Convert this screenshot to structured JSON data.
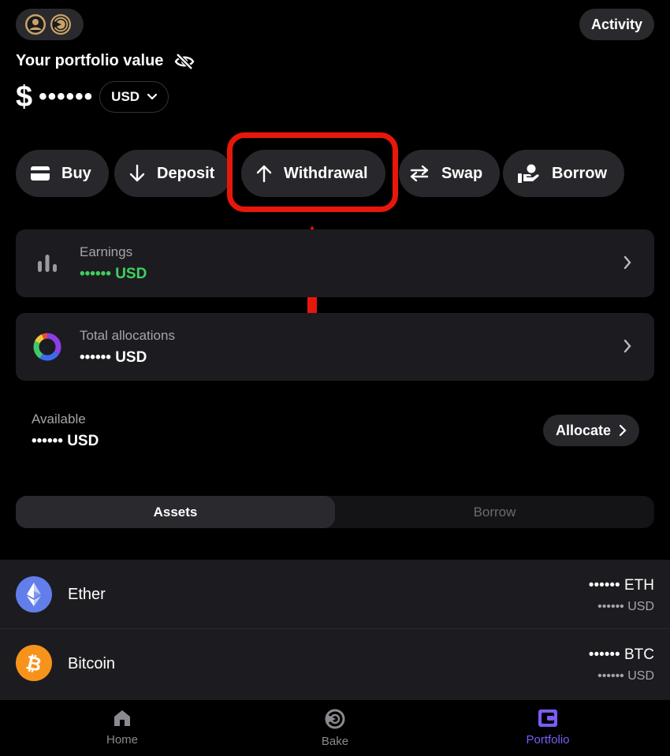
{
  "header": {
    "activity_label": "Activity"
  },
  "portfolio": {
    "title": "Your portfolio value",
    "currency_symbol": "$",
    "masked_value": "••••••",
    "currency": "USD"
  },
  "actions": [
    {
      "label": "Buy",
      "icon": "card-icon"
    },
    {
      "label": "Deposit",
      "icon": "arrow-down-icon"
    },
    {
      "label": "Withdrawal",
      "icon": "arrow-up-icon"
    },
    {
      "label": "Swap",
      "icon": "swap-icon"
    },
    {
      "label": "Borrow",
      "icon": "hand-coin-icon"
    }
  ],
  "earnings": {
    "label": "Earnings",
    "value": "•••••• USD",
    "color": "#3fd05f"
  },
  "allocations": {
    "label": "Total allocations",
    "value": "•••••• USD"
  },
  "available": {
    "label": "Available",
    "value": "•••••• USD",
    "allocate_label": "Allocate"
  },
  "tabs": {
    "assets": "Assets",
    "borrow": "Borrow"
  },
  "assets": [
    {
      "name": "Ether",
      "amount": "•••••• ETH",
      "usd": "•••••• USD",
      "icon": "ethereum-icon",
      "color": "#627eea"
    },
    {
      "name": "Bitcoin",
      "amount": "•••••• BTC",
      "usd": "•••••• USD",
      "icon": "bitcoin-icon",
      "color": "#f7931a"
    }
  ],
  "nav": {
    "home": "Home",
    "bake": "Bake",
    "portfolio": "Portfolio",
    "active_color": "#7b5cf5"
  },
  "highlight_color": "#e8170b"
}
